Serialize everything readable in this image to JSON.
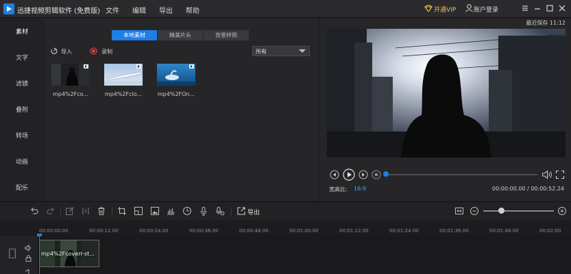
{
  "app": {
    "title": "迅捷视频剪辑软件 (免费版)",
    "menu": [
      "文件",
      "编辑",
      "导出",
      "帮助"
    ],
    "vip_label": "开通VIP",
    "account_label": "账户登录"
  },
  "sidebar": {
    "items": [
      {
        "label": "素材",
        "active": true
      },
      {
        "label": "文字"
      },
      {
        "label": "滤镜"
      },
      {
        "label": "叠附"
      },
      {
        "label": "转场"
      },
      {
        "label": "动画"
      },
      {
        "label": "配乐"
      }
    ]
  },
  "media": {
    "tabs": [
      {
        "label": "本地素材",
        "active": true
      },
      {
        "label": "精美片头"
      },
      {
        "label": "背景样例"
      }
    ],
    "import_label": "导入",
    "record_label": "录制",
    "filter_value": "所有",
    "items": [
      {
        "label": "mp4%2Fco..."
      },
      {
        "label": "mp4%2Fclo..."
      },
      {
        "label": "mp4%2FOn..."
      }
    ]
  },
  "preview": {
    "autosave": "最近保存 11:12",
    "aspect_label": "宽高比:",
    "aspect_value": "16:9",
    "time": "00:00:00.00 / 00:00:52.24",
    "progress": 0
  },
  "timeline": {
    "export_label": "导出",
    "ticks": [
      "00:00:00.00",
      "00:00:12.00",
      "00:00:24.00",
      "00:00:36.00",
      "00:00:48.00",
      "00:01:00.00",
      "00:01:12.00",
      "00:01:24.00",
      "00:01:36.00",
      "00:01:48.00",
      "00:02:00"
    ],
    "clip_label": "mp4%2Fcoverr-st..."
  },
  "colors": {
    "accent": "#1e7ee6",
    "vip": "#f0c14b",
    "background": "#1f1f21"
  }
}
